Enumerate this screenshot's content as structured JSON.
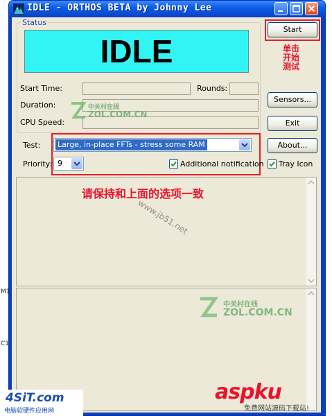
{
  "window": {
    "title": "IDLE - ORTHOS BETA by Johnny Lee"
  },
  "status": {
    "group_label": "Status",
    "display": "IDLE",
    "start_time_label": "Start Time:",
    "rounds_label": "Rounds:",
    "duration_label": "Duration:",
    "cpu_speed_label": "CPU Speed:"
  },
  "buttons": {
    "start": "Start",
    "sensors": "Sensors...",
    "exit": "Exit",
    "about": "About..."
  },
  "test": {
    "label": "Test:",
    "value": "Large, in-place FFTs - stress some RAM"
  },
  "priority": {
    "label": "Priority:",
    "value": "9"
  },
  "checkboxes": {
    "additional_notification": "Additional notification",
    "tray_icon": "Tray Icon"
  },
  "annotations": {
    "start_hint": "单击开始测试",
    "keep_options_hint": "请保持和上面的选项一致"
  },
  "watermarks": {
    "zol_cn": "中关村在线",
    "zol_en": "ZOL.COM.CN",
    "jb51": "www.jb51.net",
    "site_4sit": "4SiT.com",
    "site_4sit_sub": "电脑软硬件应用网",
    "asp": "aspku",
    "asp_sub": "免费网站源码下载站!"
  },
  "side_labels": {
    "m1": "M1",
    "c1": "C1"
  },
  "colors": {
    "title_bar": "#0c5de6",
    "status_display": "#33f4f4",
    "annotation_red": "#e8142c",
    "window_face": "#ece9d8"
  },
  "icons": {
    "app": "mountain-icon",
    "minimize": "minimize-icon",
    "maximize": "maximize-icon",
    "close": "close-icon",
    "dropdown": "chevron-down-icon",
    "check": "check-icon"
  }
}
